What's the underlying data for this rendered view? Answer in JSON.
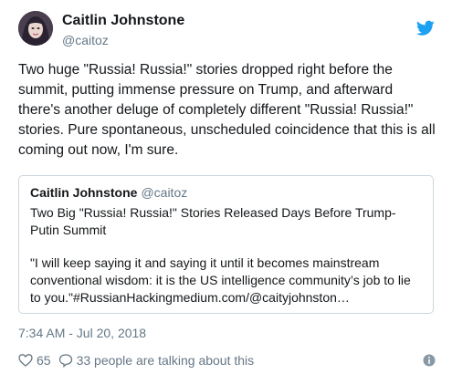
{
  "author": {
    "name": "Caitlin Johnstone",
    "handle": "@caitoz"
  },
  "tweet": {
    "text": "Two huge \"Russia! Russia!\" stories dropped right before the summit, putting immense pressure on Trump, and afterward there's another deluge of completely different \"Russia! Russia!\" stories. Pure spontaneous, unscheduled coincidence that this is all coming out now, I'm sure.",
    "timestamp": "7:34 AM - Jul 20, 2018",
    "likes": "65",
    "talking": "33 people are talking about this"
  },
  "quoted": {
    "name": "Caitlin Johnstone",
    "handle": "@caitoz",
    "title": "Two Big \"Russia! Russia!\" Stories Released Days Before Trump-Putin Summit",
    "body": "\"I will keep saying it and saying it until it becomes mainstream conventional wisdom: it is the US intelligence community’s job to lie to you.\"#RussianHackingmedium.com/@caityjohnston…"
  },
  "icons": {
    "brand": "twitter-bird-icon",
    "like": "heart-icon",
    "reply": "speech-bubble-icon",
    "info": "info-icon"
  },
  "colors": {
    "brand": "#1da1f2",
    "secondary_text": "#657786",
    "border": "#ccd6dd"
  }
}
